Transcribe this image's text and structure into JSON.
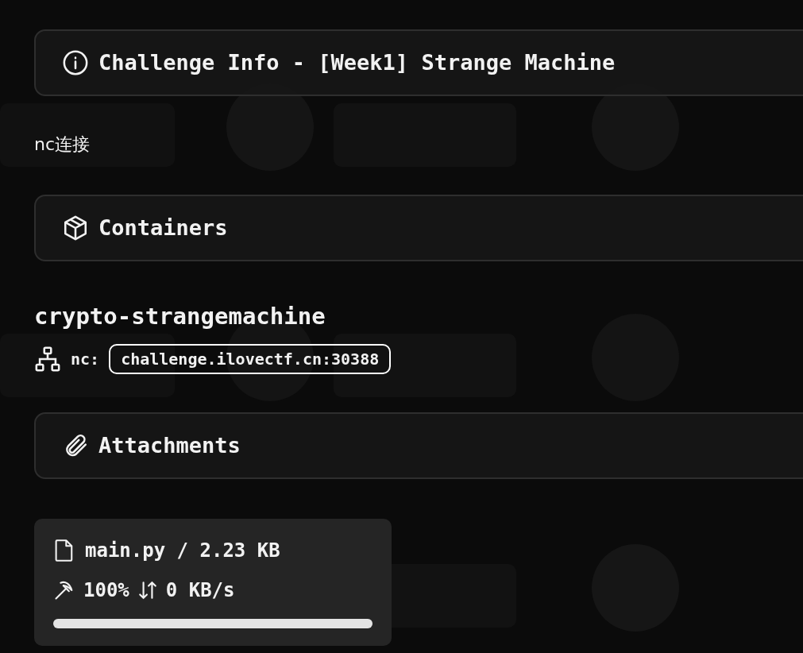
{
  "info_panel": {
    "title": "Challenge Info - [Week1] Strange Machine"
  },
  "description": "nc连接",
  "containers_panel": {
    "title": "Containers"
  },
  "container": {
    "name": "crypto-strangemachine",
    "protocol_label": "nc:",
    "address": "challenge.ilovectf.cn:30388"
  },
  "attachments_panel": {
    "title": "Attachments"
  },
  "attachments": [
    {
      "file": "main.py / 2.23 KB",
      "progress": "100%",
      "speed": "0 KB/s",
      "level": 1
    }
  ]
}
